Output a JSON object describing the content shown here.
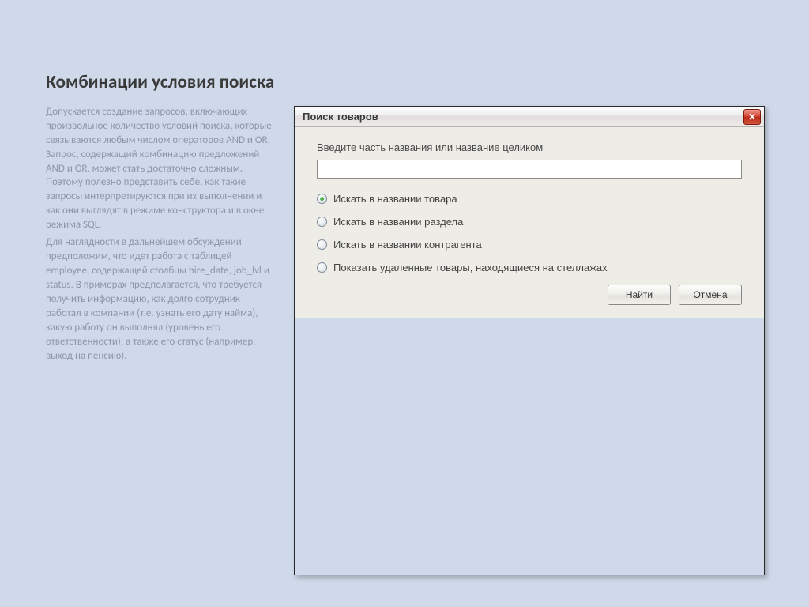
{
  "title": "Комбинации условия поиска",
  "paragraphs": [
    "Допускается создание запросов, включающих произвольное количество условий поиска, которые связываются любым числом операторов AND и OR. Запрос, содержащий комбинацию предложений AND и OR, может стать достаточно сложным. Поэтому полезно представить себе, как такие запросы интерпретируются при их выполнении и как они выглядят в режиме конструктора и в окне режима SQL.",
    "Для наглядности в дальнейшем обсуждении предположим, что идет работа с таблицей employee, содержащей столбцы hire_date, job_lvl и status. В примерах предполагается, что требуется получить информацию, как долго сотрудник работал в компании (т.е. узнать его дату найма), какую работу он выполнял (уровень его ответственности), а также его статус (например, выход на пенсию)."
  ],
  "dialog": {
    "title": "Поиск товаров",
    "prompt": "Введите часть названия или название целиком",
    "input_value": "",
    "options": [
      {
        "label": "Искать в названии товара",
        "selected": true
      },
      {
        "label": "Искать в названии раздела",
        "selected": false
      },
      {
        "label": "Искать в названии контрагента",
        "selected": false
      },
      {
        "label": "Показать удаленные товары, находящиеся на стеллажах",
        "selected": false
      }
    ],
    "buttons": {
      "find": "Найти",
      "cancel": "Отмена"
    }
  }
}
